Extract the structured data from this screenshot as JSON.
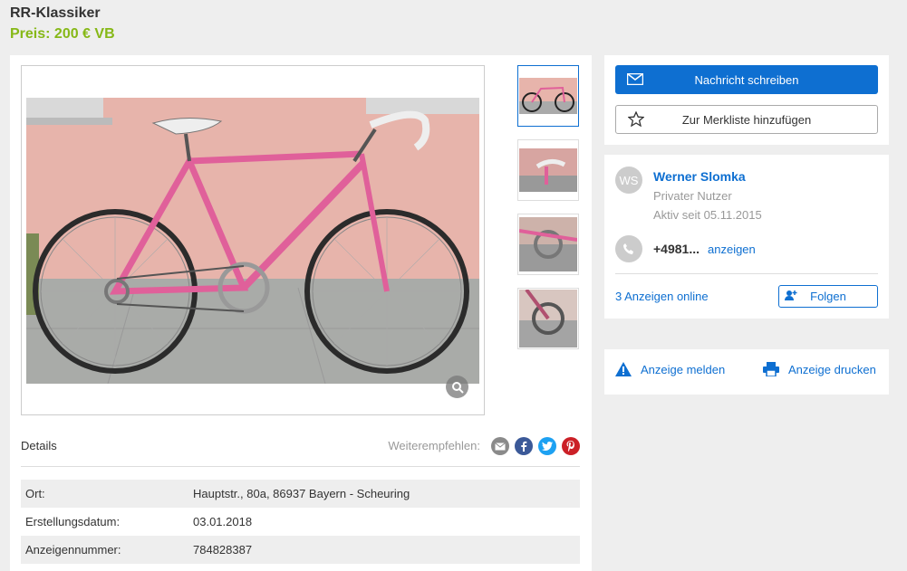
{
  "listing": {
    "title": "RR-Klassiker",
    "price": "Preis: 200 € VB"
  },
  "gallery": {
    "thumbnail_count": 4,
    "zoom_icon": "magnifier-icon"
  },
  "details": {
    "label": "Details",
    "share_label": "Weiterempfehlen:",
    "share_icons": [
      "email-icon",
      "facebook-icon",
      "twitter-icon",
      "pinterest-icon"
    ],
    "rows": [
      {
        "key": "Ort:",
        "value": "Hauptstr., 80a, 86937 Bayern - Scheuring"
      },
      {
        "key": "Erstellungsdatum:",
        "value": "03.01.2018"
      },
      {
        "key": "Anzeigennummer:",
        "value": "784828387"
      }
    ]
  },
  "actions": {
    "message_label": "Nachricht schreiben",
    "watchlist_label": "Zur Merkliste hinzufügen"
  },
  "seller": {
    "initials": "WS",
    "name": "Werner Slomka",
    "type": "Privater Nutzer",
    "active_since": "Aktiv seit 05.11.2015",
    "phone_partial": "+4981...",
    "phone_show": "anzeigen",
    "ads_online": "3 Anzeigen online",
    "follow_label": "Folgen"
  },
  "report": {
    "report_label": "Anzeige melden",
    "print_label": "Anzeige drucken"
  },
  "colors": {
    "accent": "#0e6fd1",
    "price": "#86b817",
    "background": "#eeeeee"
  }
}
